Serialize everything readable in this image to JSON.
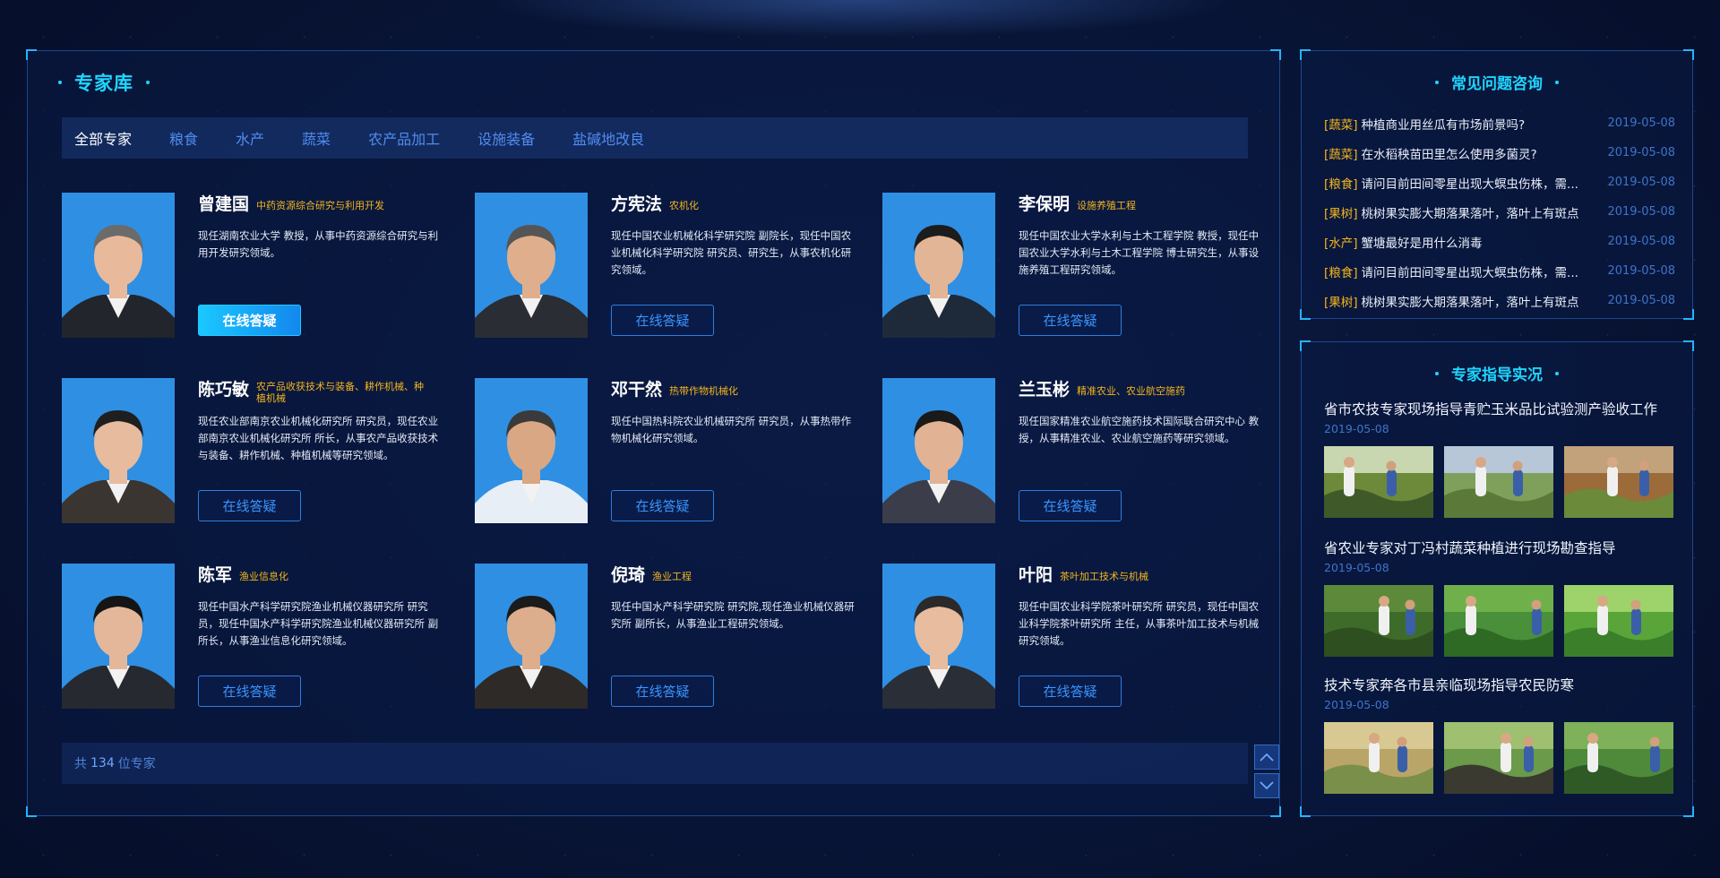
{
  "expert_library": {
    "title": "专家库",
    "tabs": [
      "全部专家",
      "粮食",
      "水产",
      "蔬菜",
      "农产品加工",
      "设施装备",
      "盐碱地改良"
    ],
    "active_tab": "全部专家",
    "consult_label": "在线答疑",
    "experts": [
      {
        "name": "曾建国",
        "field": "中药资源综合研究与利用开发",
        "desc": "现任湖南农业大学 教授，从事中药资源综合研究与利用开发研究领域。",
        "primary": true
      },
      {
        "name": "方宪法",
        "field": "农机化",
        "desc": "现任中国农业机械化科学研究院 副院长，现任中国农业机械化科学研究院 研究员、研究生，从事农机化研究领域。"
      },
      {
        "name": "李保明",
        "field": "设施养殖工程",
        "desc": "现任中国农业大学水利与土木工程学院 教授，现任中国农业大学水利与土木工程学院 博士研究生，从事设施养殖工程研究领域。"
      },
      {
        "name": "陈巧敏",
        "field": "农产品收获技术与装备、耕作机械、种植机械",
        "desc": "现任农业部南京农业机械化研究所 研究员，现任农业部南京农业机械化研究所 所长，从事农产品收获技术与装备、耕作机械、种植机械等研究领域。"
      },
      {
        "name": "邓干然",
        "field": "热带作物机械化",
        "desc": "现任中国热科院农业机械研究所 研究员，从事热带作物机械化研究领域。"
      },
      {
        "name": "兰玉彬",
        "field": "精准农业、农业航空施药",
        "desc": "现任国家精准农业航空施药技术国际联合研究中心 教授，从事精准农业、农业航空施药等研究领域。"
      },
      {
        "name": "陈军",
        "field": "渔业信息化",
        "desc": "现任中国水产科学研究院渔业机械仪器研究所 研究员，现任中国水产科学研究院渔业机械仪器研究所 副所长，从事渔业信息化研究领域。"
      },
      {
        "name": "倪琦",
        "field": "渔业工程",
        "desc": "现任中国水产科学研究院 研究院,现任渔业机械仪器研究所 副所长，从事渔业工程研究领域。"
      },
      {
        "name": "叶阳",
        "field": "茶叶加工技术与机械",
        "desc": "现任中国农业科学院茶叶研究所 研究员，现任中国农业科学院茶叶研究所 主任，从事茶叶加工技术与机械研究领域。"
      }
    ],
    "footer": {
      "prefix": "共",
      "count": "134",
      "suffix": "位专家"
    }
  },
  "faq": {
    "title": "常见问题咨询",
    "items": [
      {
        "tag": "[蔬菜]",
        "question": "种植商业用丝瓜有市场前景吗?",
        "date": "2019-05-08"
      },
      {
        "tag": "[蔬菜]",
        "question": "在水稻秧苗田里怎么使用多菌灵?",
        "date": "2019-05-08"
      },
      {
        "tag": "[粮食]",
        "question": "请问目前田间零星出现大螟虫伤株，需...",
        "date": "2019-05-08"
      },
      {
        "tag": "[果树]",
        "question": "桃树果实膨大期落果落叶，落叶上有斑点",
        "date": "2019-05-08"
      },
      {
        "tag": "[水产]",
        "question": "蟹塘最好是用什么消毒",
        "date": "2019-05-08"
      },
      {
        "tag": "[粮食]",
        "question": "请问目前田间零星出现大螟虫伤株，需...",
        "date": "2019-05-08"
      },
      {
        "tag": "[果树]",
        "question": "桃树果实膨大期落果落叶，落叶上有斑点",
        "date": "2019-05-08"
      }
    ]
  },
  "field_guidance": {
    "title": "专家指导实况",
    "reports": [
      {
        "title": "省市农技专家现场指导青贮玉米品比试验测产验收工作",
        "date": "2019-05-08"
      },
      {
        "title": "省农业专家对丁冯村蔬菜种植进行现场勘查指导",
        "date": "2019-05-08"
      },
      {
        "title": "技术专家奔各市县亲临现场指导农民防寒",
        "date": "2019-05-08"
      }
    ]
  },
  "colors": {
    "accent": "#1fd6ff",
    "tag": "#f3b51c",
    "link": "#3a95ff"
  }
}
